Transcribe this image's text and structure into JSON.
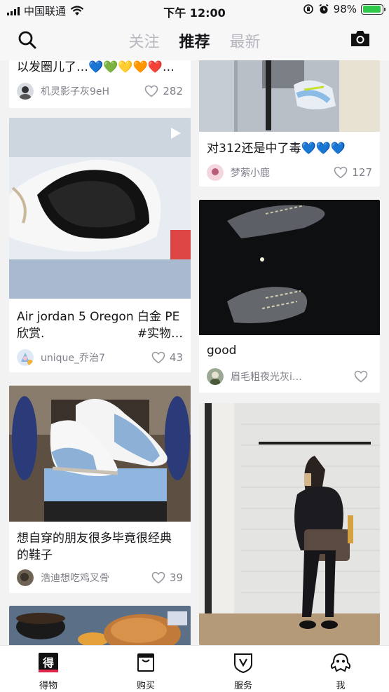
{
  "status_bar": {
    "carrier": "中国联通",
    "time": "下午 12:00",
    "battery": "98%",
    "battery_level": 0.98
  },
  "header": {
    "tabs": [
      {
        "label": "关注",
        "active": false
      },
      {
        "label": "推荐",
        "active": true
      },
      {
        "label": "最新",
        "active": false
      }
    ],
    "icons": [
      "search-icon",
      "camera-icon"
    ]
  },
  "feed": {
    "left_column": [
      {
        "title": "以发圈儿了…💙💚💛🧡❤️…",
        "author": "机灵影子灰9eH",
        "likes": "282"
      },
      {
        "title_line1": "Air jordan 5 Oregon 白金 PE",
        "title_line2_left": "欣赏.",
        "title_line2_right": "#实物…",
        "author": "unique_乔治7",
        "likes": "43",
        "has_video": true
      },
      {
        "title_line1": "想自穿的朋友很多毕竟很经典",
        "title_line2": "的鞋子",
        "author": "浩迪想吃鸡叉骨",
        "likes": "39"
      }
    ],
    "right_column": [
      {
        "title": "对312还是中了毒💙💙💙",
        "author": "梦萦小鹿",
        "likes": "127"
      },
      {
        "title": "good",
        "author": "眉毛粗夜光灰i…",
        "likes": ""
      }
    ]
  },
  "tabbar": {
    "items": [
      {
        "label": "得物",
        "icon": "dewu-logo-icon",
        "active": true
      },
      {
        "label": "购买",
        "icon": "shopping-bag-icon",
        "active": false
      },
      {
        "label": "服务",
        "icon": "service-shield-icon",
        "active": false
      },
      {
        "label": "我",
        "icon": "profile-mascot-icon",
        "active": false
      }
    ]
  }
}
